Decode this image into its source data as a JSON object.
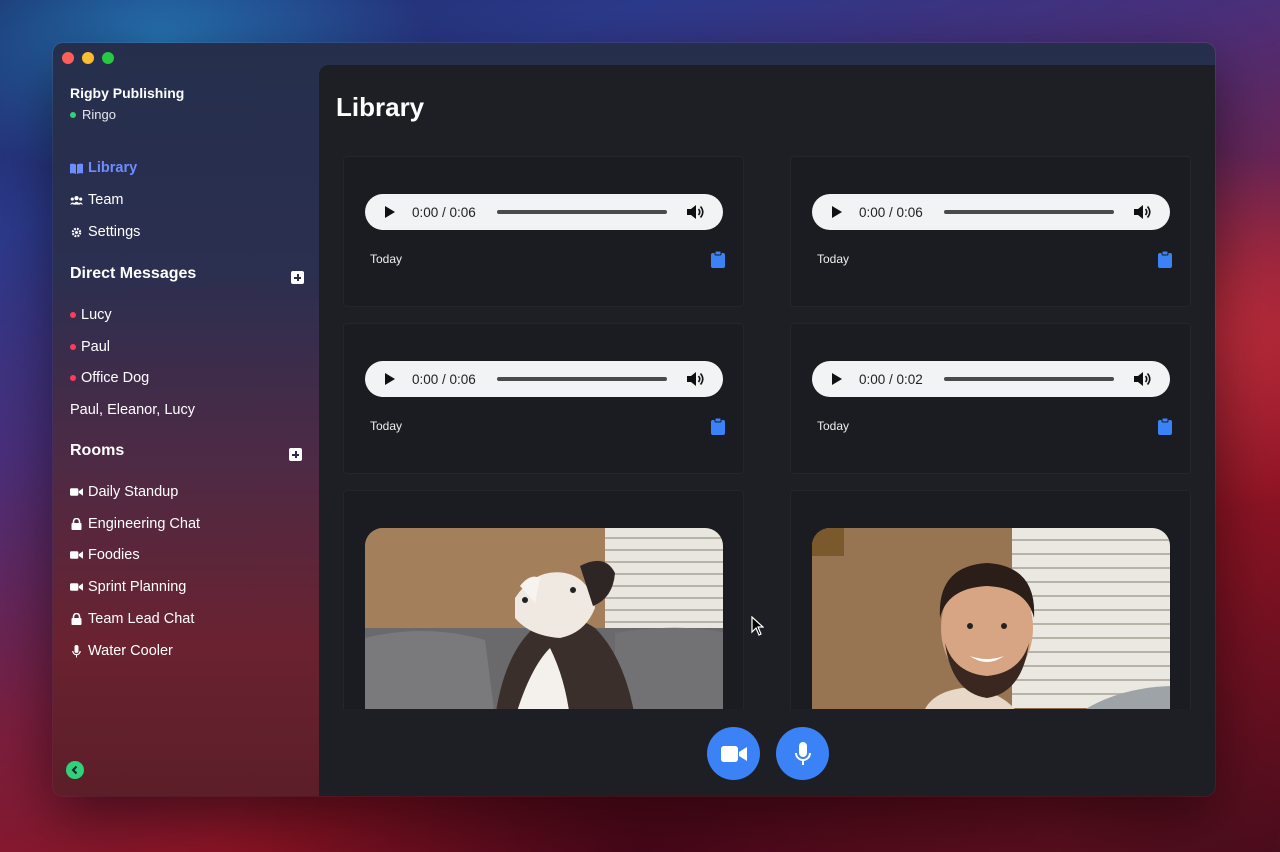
{
  "window": {
    "traffic_lights": [
      "close",
      "minimize",
      "maximize"
    ]
  },
  "sidebar": {
    "org_name": "Rigby Publishing",
    "user_name": "Ringo",
    "user_status_color": "#2fd17a",
    "nav": [
      {
        "label": "Library",
        "icon": "book-icon",
        "active": true
      },
      {
        "label": "Team",
        "icon": "users-icon",
        "active": false
      },
      {
        "label": "Settings",
        "icon": "gear-icon",
        "active": false
      }
    ],
    "direct_messages": {
      "title": "Direct Messages",
      "items": [
        {
          "label": "Lucy",
          "online": true
        },
        {
          "label": "Paul",
          "online": true
        },
        {
          "label": "Office Dog",
          "online": true
        },
        {
          "label": "Paul, Eleanor, Lucy",
          "online": false
        }
      ]
    },
    "rooms": {
      "title": "Rooms",
      "items": [
        {
          "label": "Daily Standup",
          "icon": "video-camera-icon"
        },
        {
          "label": "Engineering Chat",
          "icon": "lock-icon"
        },
        {
          "label": "Foodies",
          "icon": "video-camera-icon"
        },
        {
          "label": "Sprint Planning",
          "icon": "video-camera-icon"
        },
        {
          "label": "Team Lead Chat",
          "icon": "lock-icon"
        },
        {
          "label": "Water Cooler",
          "icon": "microphone-icon"
        }
      ]
    }
  },
  "main": {
    "title": "Library",
    "audio_cards": [
      {
        "time": "0:00 / 0:06",
        "date": "Today"
      },
      {
        "time": "0:00 / 0:06",
        "date": "Today"
      },
      {
        "time": "0:00 / 0:06",
        "date": "Today"
      },
      {
        "time": "0:00 / 0:02",
        "date": "Today"
      }
    ],
    "video_cards": [
      {
        "subject": "dog"
      },
      {
        "subject": "person"
      }
    ],
    "controls": [
      "video-camera-icon",
      "microphone-icon"
    ]
  },
  "colors": {
    "accent": "#3b82f6",
    "active_nav": "#6f8cff",
    "dm_status": "#ff3b5c",
    "main_bg": "#1d1f25"
  }
}
